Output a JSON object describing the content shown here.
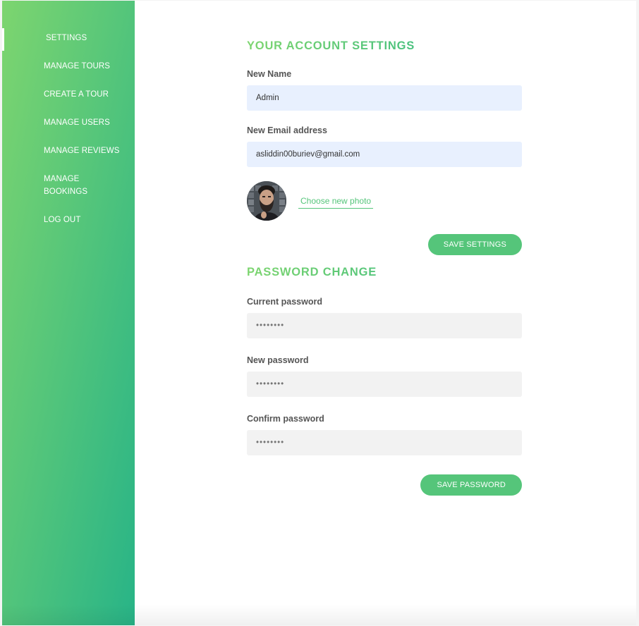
{
  "sidebar": {
    "items": [
      {
        "label": "SETTINGS",
        "active": true
      },
      {
        "label": "MANAGE TOURS"
      },
      {
        "label": "CREATE A TOUR"
      },
      {
        "label": "MANAGE USERS"
      },
      {
        "label": "MANAGE REVIEWS"
      },
      {
        "label": "MANAGE BOOKINGS"
      },
      {
        "label": "LOG OUT"
      }
    ]
  },
  "account": {
    "heading": "YOUR ACCOUNT SETTINGS",
    "name_label": "New Name",
    "name_value": "Admin",
    "email_label": "New Email address",
    "email_value": "asliddin00buriev@gmail.com",
    "photo_link": "Choose new photo",
    "save_button": "SAVE SETTINGS"
  },
  "password": {
    "heading": "PASSWORD CHANGE",
    "current_label": "Current password",
    "current_placeholder": "••••••••",
    "new_label": "New password",
    "new_placeholder": "••••••••",
    "confirm_label": "Confirm password",
    "confirm_placeholder": "••••••••",
    "save_button": "SAVE PASSWORD"
  },
  "colors": {
    "accent": "#55c57a",
    "gradient_start": "#7dd56f",
    "gradient_end": "#28b487"
  }
}
